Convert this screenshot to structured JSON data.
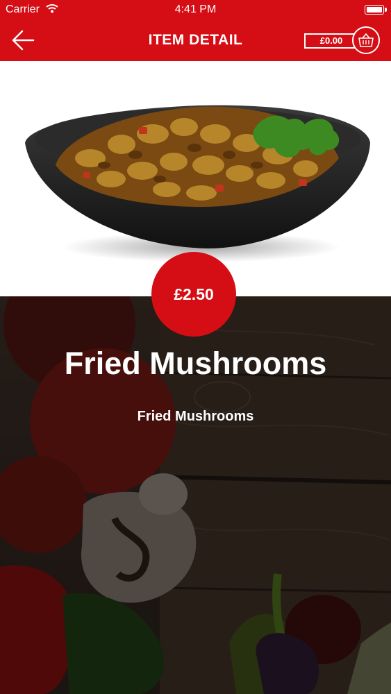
{
  "status_bar": {
    "carrier": "Carrier",
    "time": "4:41 PM"
  },
  "nav": {
    "title": "ITEM DETAIL",
    "cart_total": "£0.00"
  },
  "item": {
    "price": "£2.50",
    "name": "Fried Mushrooms",
    "description": "Fried Mushrooms"
  },
  "colors": {
    "brand_red": "#d50d14"
  },
  "icons": [
    "back-arrow-icon",
    "basket-icon",
    "wifi-icon",
    "battery-icon"
  ]
}
